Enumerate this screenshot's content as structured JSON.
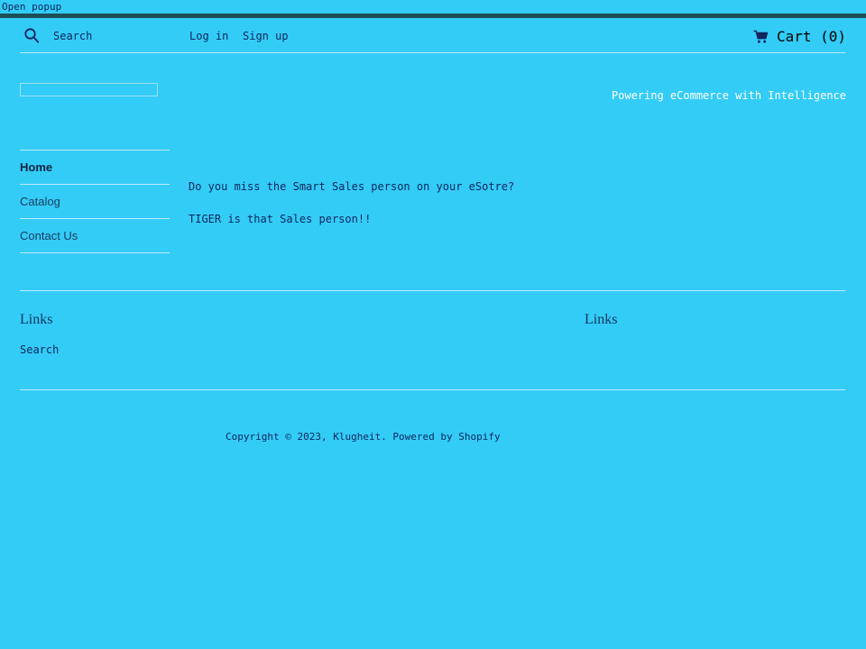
{
  "browser": {
    "popup_label": "Open popup"
  },
  "colors": {
    "page_background": "#33ccf7",
    "dark_rule": "#1d4f57",
    "hairline": "#bfe9fb",
    "text_dark": "#11265c",
    "text_white": "#ffffff",
    "heading": "#14365e"
  },
  "header": {
    "search_icon": "search-icon",
    "search_label": "Search",
    "login_label": "Log in",
    "signup_label": "Sign up",
    "cart_icon": "shopping-cart-icon",
    "cart_label": "Cart (0)",
    "cart_count": 0
  },
  "search": {
    "value": "",
    "placeholder": ""
  },
  "tagline": "Powering eCommerce with Intelligence",
  "nav": {
    "items": [
      {
        "label": "Home",
        "active": true
      },
      {
        "label": "Catalog",
        "active": false
      },
      {
        "label": "Contact Us",
        "active": false
      }
    ]
  },
  "main": {
    "lines": [
      "Do you miss the Smart Sales person on your eSotre?",
      "TIGER is that Sales person!!"
    ]
  },
  "footer": {
    "left": {
      "heading": "Links",
      "links": [
        "Search"
      ]
    },
    "right": {
      "heading": "Links"
    },
    "copyright": "Copyright © 2023, Klugheit. Powered by Shopify"
  }
}
